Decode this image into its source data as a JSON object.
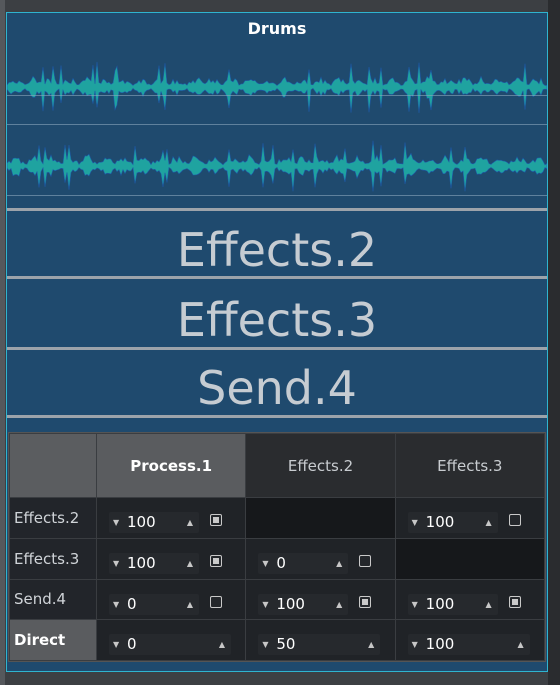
{
  "clip": {
    "title": "Drums"
  },
  "lanes": [
    "Effects.2",
    "Effects.3",
    "Send.4"
  ],
  "matrix": {
    "columns": [
      {
        "label": "Process.1",
        "active": true
      },
      {
        "label": "Effects.2",
        "active": false
      },
      {
        "label": "Effects.3",
        "active": false
      }
    ],
    "rows": [
      {
        "label": "Effects.2",
        "active": false,
        "cells": [
          {
            "value": "100",
            "checked": true
          },
          null,
          {
            "value": "100",
            "checked": false
          }
        ]
      },
      {
        "label": "Effects.3",
        "active": false,
        "cells": [
          {
            "value": "100",
            "checked": true
          },
          {
            "value": "0",
            "checked": false
          },
          null
        ]
      },
      {
        "label": "Send.4",
        "active": false,
        "cells": [
          {
            "value": "0",
            "checked": false
          },
          {
            "value": "100",
            "checked": true
          },
          {
            "value": "100",
            "checked": true
          }
        ]
      },
      {
        "label": "Direct",
        "active": true,
        "cells": [
          {
            "value": "0",
            "checked": null
          },
          {
            "value": "50",
            "checked": null
          },
          {
            "value": "100",
            "checked": null
          }
        ]
      }
    ]
  },
  "colors": {
    "accent": "#2fb4cf",
    "clip_bg": "#1f4a6e",
    "waveform": "#1fa3a0"
  }
}
